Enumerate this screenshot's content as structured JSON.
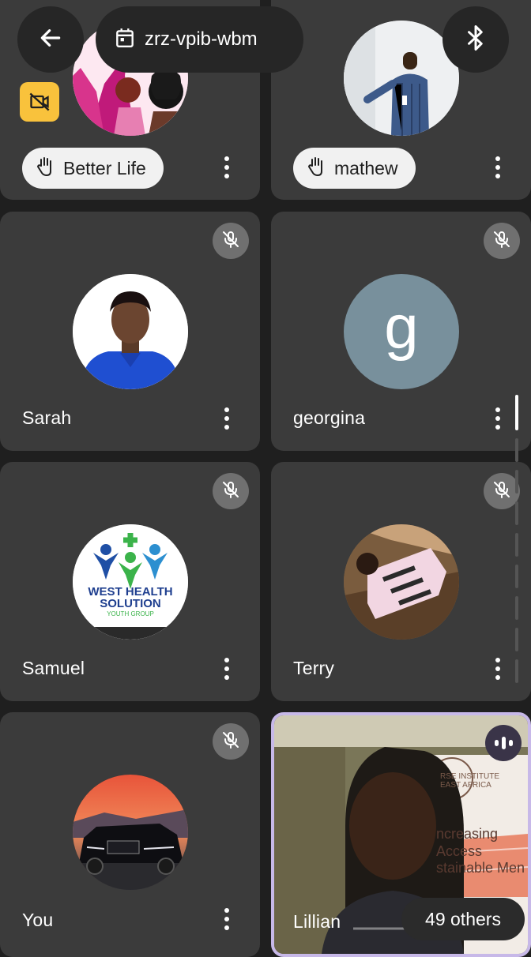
{
  "meeting": {
    "code": "zrz-vpib-wbm",
    "others_label": "49 others"
  },
  "participants": [
    {
      "name": "Better Life",
      "hand_raised": true
    },
    {
      "name": "mathew",
      "hand_raised": true
    },
    {
      "name": "Sarah",
      "muted": true
    },
    {
      "name": "georgina",
      "muted": true,
      "initial": "g"
    },
    {
      "name": "Samuel",
      "muted": true,
      "logo_text": [
        "WEST HEALTH",
        "SOLUTION",
        "YOUTH GROUP"
      ]
    },
    {
      "name": "Terry",
      "muted": true
    },
    {
      "name": "You",
      "muted": true
    },
    {
      "name": "Lillian",
      "speaking": true,
      "video_text": [
        "RSE INSTITUTE",
        "EAST AFRICA",
        "ncreasing Access",
        "stainable Men"
      ]
    }
  ],
  "icons": {
    "back": "arrow-left-icon",
    "calendar": "calendar-icon",
    "bluetooth": "bluetooth-icon",
    "mic_off": "mic-off-icon",
    "hand": "raised-hand-icon",
    "more": "more-vert-icon",
    "no_video": "video-off-icon",
    "speaking": "audio-level-icon"
  },
  "colors": {
    "background": "#1f1f1f",
    "tile": "#3b3b3b",
    "georgina_avatar": "#78909c",
    "active_speaker_border": "#c7b8e8",
    "status_yellow": "#f9c23c"
  }
}
